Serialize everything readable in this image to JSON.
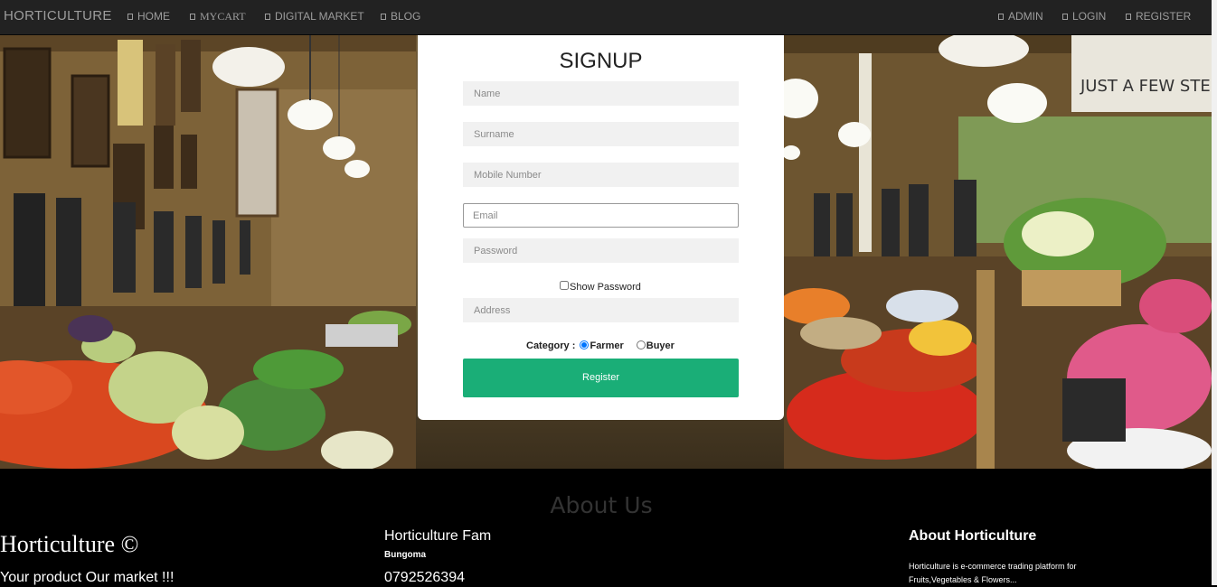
{
  "navbar": {
    "brand": "HORTICULTURE",
    "left_items": [
      {
        "label": "HOME",
        "icon": "home-icon"
      },
      {
        "label": "MYCART",
        "icon": "cart-icon"
      },
      {
        "label": "DIGITAL MARKET",
        "icon": "market-icon"
      },
      {
        "label": "BLOG",
        "icon": "blog-icon"
      }
    ],
    "right_items": [
      {
        "label": "ADMIN",
        "icon": "user-icon"
      },
      {
        "label": "LOGIN",
        "icon": "login-icon"
      },
      {
        "label": "REGISTER",
        "icon": "register-icon"
      }
    ]
  },
  "signup": {
    "title": "SIGNUP",
    "fields": {
      "name": {
        "placeholder": "Name"
      },
      "surname": {
        "placeholder": "Surname"
      },
      "mobile": {
        "placeholder": "Mobile Number"
      },
      "email": {
        "placeholder": "Email"
      },
      "password": {
        "placeholder": "Password"
      },
      "address": {
        "placeholder": "Address"
      }
    },
    "show_password_label": "Show Password",
    "category_label": "Category :",
    "category_options": [
      "Farmer",
      "Buyer"
    ],
    "category_selected": "Farmer",
    "register_label": "Register"
  },
  "hero": {
    "sign_text": "JUST A FEW STEP"
  },
  "footer": {
    "heading": "About Us",
    "col1": {
      "title": "Horticulture ©",
      "subtitle": "Your product Our market !!!"
    },
    "col2": {
      "title": "Horticulture Fam",
      "location": "Bungoma",
      "phone": "0792526394"
    },
    "col3": {
      "title": "About Horticulture",
      "text": "Horticulture is e-commerce trading platform for Fruits,Vegetables & Flowers..."
    }
  },
  "colors": {
    "navbar_bg": "#222222",
    "accent_green": "#1aae77",
    "footer_bg": "#000000"
  }
}
